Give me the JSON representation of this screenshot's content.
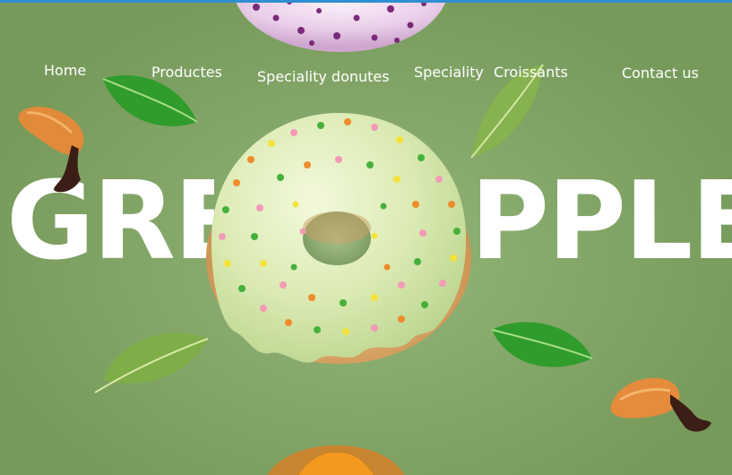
{
  "nav": {
    "items": [
      {
        "label": "Home"
      },
      {
        "label": "Productes"
      },
      {
        "label": "Speciality donutes"
      },
      {
        "label": "Speciality"
      },
      {
        "label": "Croissants"
      },
      {
        "label": "Contact us"
      }
    ]
  },
  "hero": {
    "left_text": "GRE",
    "right_text": "PPLE"
  },
  "colors": {
    "background": "#86a96b",
    "text": "#ffffff",
    "top_border": "#2f8fd0",
    "glaze": "#dfeeb8",
    "leaf": "#2f9c2c"
  },
  "icons": {
    "main_product": "glazed-donut-illustration",
    "top_product": "pink-donut-illustration",
    "bottom_product": "pastry-illustration",
    "leaves": "leaf-illustration",
    "croissant": "chocolate-croissant-illustration"
  }
}
